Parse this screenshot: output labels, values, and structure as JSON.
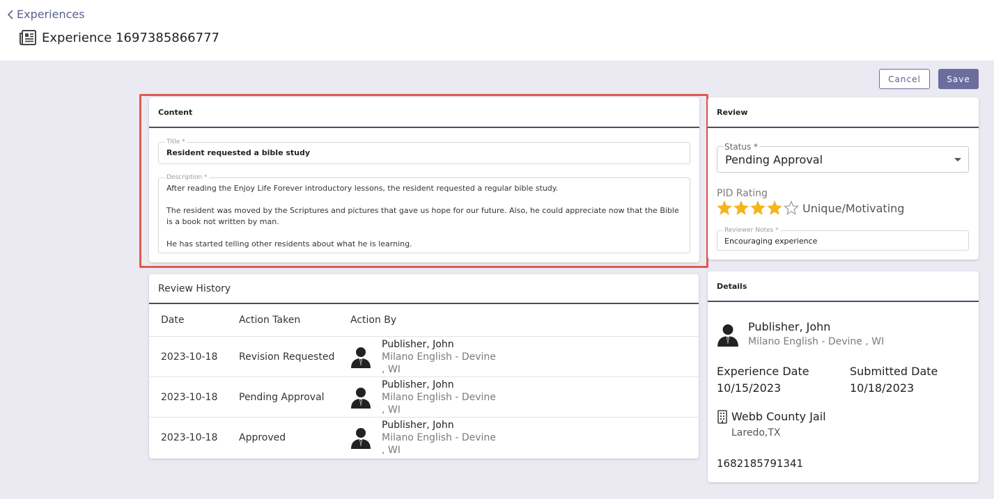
{
  "header": {
    "back_label": "Experiences",
    "title": "Experience 1697385866777"
  },
  "actions": {
    "cancel_label": "Cancel",
    "save_label": "Save"
  },
  "content": {
    "heading": "Content",
    "title_label": "Title *",
    "title_value": "Resident requested a bible study",
    "description_label": "Description *",
    "description_paragraphs": [
      "After reading the Enjoy Life Forever introductory lessons, the resident requested a regular bible study.",
      "The resident was moved by the Scriptures and pictures that gave us hope for our future. Also, he could appreciate now that the Bible is a book not written by man.",
      "He has started telling other residents about what he is learning."
    ]
  },
  "review_history": {
    "heading": "Review History",
    "columns": [
      "Date",
      "Action Taken",
      "Action By"
    ],
    "rows": [
      {
        "date": "2023-10-18",
        "action": "Revision Requested",
        "by_name": "Publisher, John",
        "by_location": "Milano English - Devine , WI"
      },
      {
        "date": "2023-10-18",
        "action": "Pending Approval",
        "by_name": "Publisher, John",
        "by_location": "Milano English - Devine , WI"
      },
      {
        "date": "2023-10-18",
        "action": "Approved",
        "by_name": "Publisher, John",
        "by_location": "Milano English - Devine , WI"
      }
    ]
  },
  "review": {
    "heading": "Review",
    "status_label": "Status *",
    "status_value": "Pending Approval",
    "pid_label": "PID Rating",
    "pid_rating": 4,
    "pid_max": 5,
    "pid_text": "Unique/Motivating",
    "notes_label": "Reviewer Notes *",
    "notes_value": "Encouraging experience",
    "star_color": "#f2b51b"
  },
  "details": {
    "heading": "Details",
    "person_name": "Publisher, John",
    "person_location": "Milano English - Devine , WI",
    "experience_date_label": "Experience Date",
    "experience_date": "10/15/2023",
    "submitted_date_label": "Submitted Date",
    "submitted_date": "10/18/2023",
    "facility_name": "Webb County Jail",
    "facility_city": "Laredo,TX",
    "facility_id": "1682185791341"
  },
  "colors": {
    "accent": "#6b6d9c",
    "highlight": "#e05a4f",
    "background": "#ebe9f1"
  }
}
